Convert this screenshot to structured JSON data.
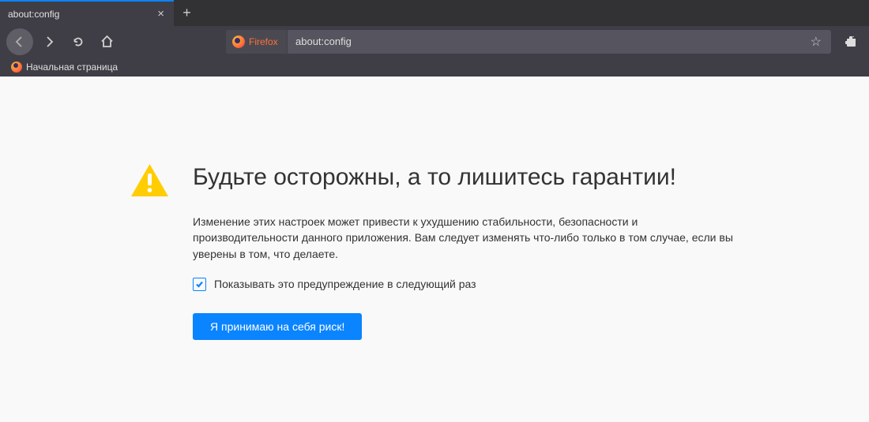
{
  "tab": {
    "title": "about:config"
  },
  "urlbar": {
    "badge": "Firefox",
    "url": "about:config"
  },
  "bookmarks": {
    "start_page": "Начальная страница"
  },
  "warning": {
    "title": "Будьте осторожны, а то лишитесь гарантии!",
    "body": "Изменение этих настроек может привести к ухудшению стабильности, безопасности и производительности данного приложения. Вам следует изменять что-либо только в том случае, если вы уверены в том, что делаете.",
    "checkbox_label": "Показывать это предупреждение в следующий раз",
    "button": "Я принимаю на себя риск!"
  }
}
